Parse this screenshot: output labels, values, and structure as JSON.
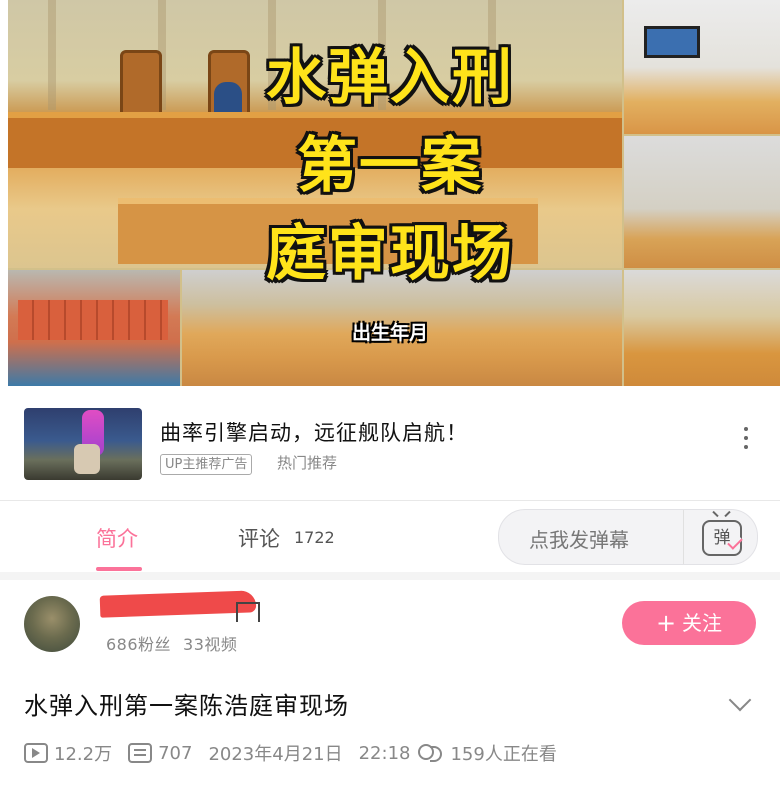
{
  "video": {
    "overlay_title_lines": [
      "水弹入刑",
      "第一案",
      "庭审现场"
    ],
    "subtitle": "出生年月"
  },
  "ad": {
    "title": "曲率引擎启动，远征舰队启航！",
    "tag": "UP主推荐广告",
    "subtitle": "热门推荐"
  },
  "tabs": {
    "intro_label": "简介",
    "comments_label": "评论",
    "comments_count": "1722",
    "danmaku_placeholder": "点我发弹幕",
    "danmaku_icon_char": "弹"
  },
  "uploader": {
    "followers": "686粉丝",
    "videos": "33视频",
    "follow_label": "关注"
  },
  "details": {
    "title": "水弹入刑第一案陈浩庭审现场",
    "views": "12.2万",
    "danmaku_count": "707",
    "date": "2023年4月21日",
    "time": "22:18",
    "watching": "159人正在看"
  },
  "colors": {
    "accent": "#fb7299",
    "overlay_text": "#ffe31a"
  },
  "icons": [
    "more-vertical-icon",
    "danmaku-icon",
    "plus-icon",
    "chevron-down-icon",
    "play-count-icon",
    "danmaku-count-icon",
    "watching-icon"
  ]
}
